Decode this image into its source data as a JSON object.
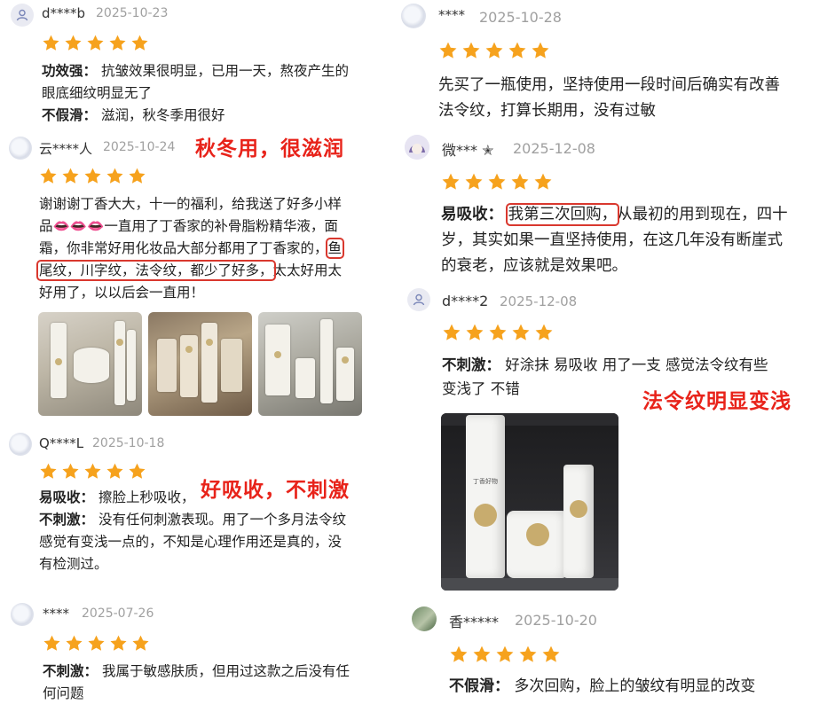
{
  "colors": {
    "star": "#f6a21d",
    "annotation": "#e8231a",
    "box": "#d9382e"
  },
  "reviews": {
    "r1": {
      "user": "d****b",
      "date": "2025-10-23",
      "rating": 5,
      "avatar_icon": "user-icon",
      "label1": "功效强：",
      "text1": "抗皱效果很明显，已用一天，熬夜产生的",
      "text1b": "眼底细纹明显无了",
      "label2": "不假滑：",
      "text2": "滋润，秋冬季用很好"
    },
    "r2": {
      "user": "云****人",
      "date": "2025-10-24",
      "rating": 5,
      "avatar_icon": "cloud-avatar",
      "line1": "谢谢谢丁香大大，十一的福利，给我送了好多小样",
      "line2a": "品",
      "lips": "👄👄👄",
      "line2b": "一直用了丁香家的补骨脂粉精华液，面",
      "line3a": "霜，你非常好用化妆品大部分都用了丁香家的，",
      "line3box": "鱼",
      "line4box": "尾纹，川字纹，法令纹，都少了好多，",
      "line4b": "太太好用太",
      "line5": "好用了，以以后会一直用！"
    },
    "r3": {
      "user": "Q****L",
      "date": "2025-10-18",
      "rating": 5,
      "avatar_icon": "cloud-avatar",
      "label1": "易吸收：",
      "text1": "擦脸上秒吸收，",
      "label2": "不刺激：",
      "text2": "没有任何刺激表现。用了一个多月法令纹",
      "text2b": "感觉有变浅一点的，不知是心理作用还是真的，没",
      "text2c": "有检测过。"
    },
    "r4": {
      "user": "****",
      "date": "2025-07-26",
      "rating": 5,
      "avatar_icon": "cloud-avatar",
      "label1": "不刺激：",
      "text1": "我属于敏感肤质，但用过这款之后没有任",
      "text1b": "何问题"
    },
    "r5": {
      "user": "****",
      "date": "2025-10-28",
      "rating": 5,
      "avatar_icon": "cloud-avatar",
      "line1": "先买了一瓶使用，坚持使用一段时间后确实有改善",
      "line2": "法令纹，打算长期用，没有过敏"
    },
    "r6": {
      "user": "微*** ✭",
      "date": "2025-12-08",
      "rating": 5,
      "avatar_icon": "anime-avatar",
      "label1": "易吸收：",
      "box": "我第三次回购，",
      "text1": "从最初的用到现在，四十",
      "line2": "岁，其实如果一直坚持使用，在这几年没有断崖式",
      "line3": "的衰老，应该就是效果吧。"
    },
    "r7": {
      "user": "d****2",
      "date": "2025-12-08",
      "rating": 5,
      "avatar_icon": "user-icon",
      "label1": "不刺激：",
      "text1": "好涂抹 易吸收 用了一支 感觉法令纹有些",
      "text1b": "变浅了 不错",
      "product_brand": "丁香好物"
    },
    "r8": {
      "user": "香*****",
      "date": "2025-10-20",
      "rating": 5,
      "avatar_icon": "photo-avatar",
      "label1": "不假滑：",
      "text1": "多次回购，脸上的皱纹有明显的改变"
    }
  },
  "annotations": {
    "a1": "秋冬用，很滋润",
    "a2": "好吸收，不刺激",
    "a3": "法令纹明显变浅"
  }
}
